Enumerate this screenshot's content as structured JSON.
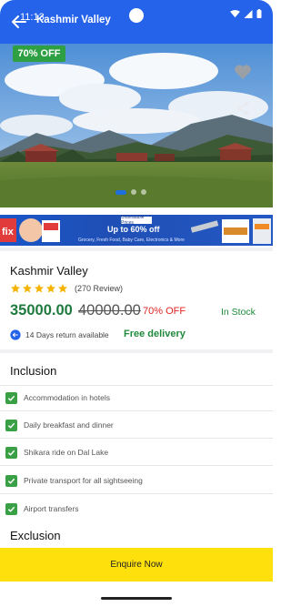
{
  "status": {
    "time": "11:13"
  },
  "header": {
    "title": "Kashmir Valley"
  },
  "hero": {
    "discount_badge": "70% OFF",
    "slide_count": 3,
    "active_slide": 0
  },
  "banner": {
    "tag": "Unbeatable Prices",
    "headline": "Up to 60% off",
    "subline": "Grocery, Fresh Food, Baby Care, Electronics & More"
  },
  "product": {
    "title": "Kashmir Valley",
    "rating": 5,
    "review_count": "(270 Review)",
    "price": "35000.00",
    "old_price": "40000.00",
    "discount": "70% OFF",
    "stock": "In Stock",
    "return_policy": "14 Days return available",
    "delivery": "Free delivery"
  },
  "inclusion": {
    "title": "Inclusion",
    "items": [
      "Accommodation in hotels",
      "Daily breakfast and dinner",
      "Shikara ride on Dal Lake",
      "Private transport for all sightseeing",
      "Airport transfers"
    ]
  },
  "exclusion": {
    "title": "Exclusion"
  },
  "footer": {
    "cta": "Enquire Now"
  },
  "colors": {
    "primary": "#2563eb",
    "price_green": "#1f7a3f",
    "discount_red": "#e02424",
    "badge_green": "#2ea043",
    "cta_yellow": "#fde00c"
  }
}
